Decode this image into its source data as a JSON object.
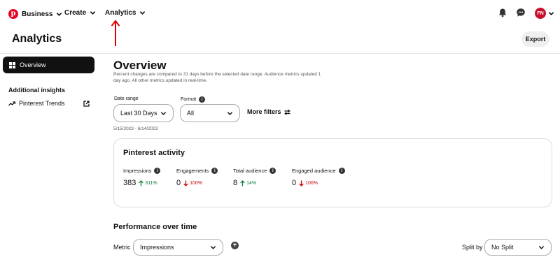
{
  "nav": {
    "business": "Business",
    "create": "Create",
    "analytics": "Analytics",
    "avatar_initials": "FN"
  },
  "header": {
    "title": "Analytics",
    "export_label": "Export"
  },
  "sidebar": {
    "active_item": "Overview",
    "section_heading": "Additional insights",
    "trends_label": "Pinterest Trends"
  },
  "overview": {
    "title": "Overview",
    "subtitle": "Percent changes are compared to 31 days before the selected date range. Audience metrics updated 1 day ago. All other metrics updated in real-time.",
    "date_range_label": "Date range",
    "date_range_value": "Last 30 Days",
    "format_label": "Format",
    "format_value": "All",
    "more_filters": "More filters",
    "date_span": "5/15/2023 - 6/14/2023"
  },
  "activity": {
    "title": "Pinterest activity",
    "metrics": [
      {
        "label": "Impressions",
        "value": "383",
        "change": "311%",
        "direction": "up"
      },
      {
        "label": "Engagements",
        "value": "0",
        "change": "100%",
        "direction": "down"
      },
      {
        "label": "Total audience",
        "value": "8",
        "change": "14%",
        "direction": "up"
      },
      {
        "label": "Engaged audience",
        "value": "0",
        "change": "100%",
        "direction": "down"
      }
    ]
  },
  "performance": {
    "title": "Performance over time",
    "metric_label": "Metric",
    "metric_value": "Impressions",
    "split_label": "Split by",
    "split_value": "No Split"
  },
  "colors": {
    "brand_red": "#e60023",
    "up_green": "#0f7a3a",
    "down_red": "#cc0000",
    "annotation_arrow": "#e00000"
  }
}
